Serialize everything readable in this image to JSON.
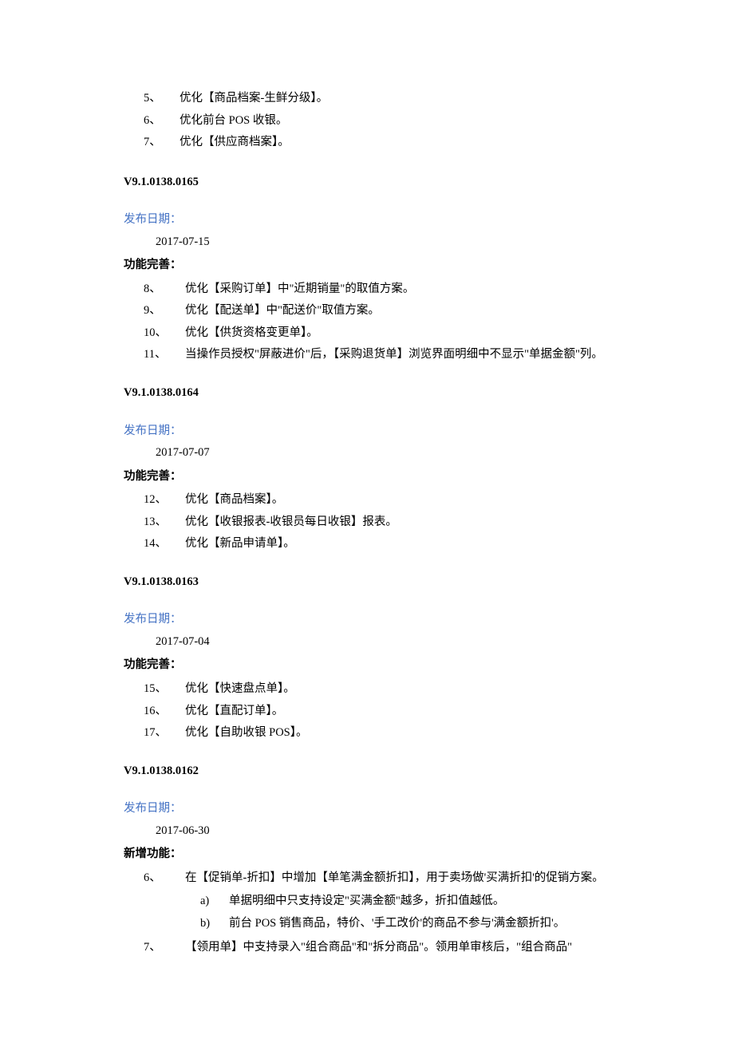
{
  "topItems": [
    {
      "num": "5、",
      "text": "优化【商品档案-生鲜分级】。"
    },
    {
      "num": "6、",
      "text": "优化前台 POS 收银。"
    },
    {
      "num": "7、",
      "text": "优化【供应商档案】。"
    }
  ],
  "labels": {
    "releaseDate": "发布日期：",
    "improvements": "功能完善：",
    "newFeatures": "新增功能："
  },
  "versions": [
    {
      "version": "V9.1.0138.0165",
      "date": "2017-07-15",
      "improvementItems": [
        {
          "num": "8、",
          "text": "优化【采购订单】中\"近期销量\"的取值方案。"
        },
        {
          "num": "9、",
          "text": "优化【配送单】中\"配送价\"取值方案。"
        },
        {
          "num": "10、",
          "text": "优化【供货资格变更单】。"
        },
        {
          "num": "11、",
          "text": "当操作员授权\"屏蔽进价\"后，【采购退货单】浏览界面明细中不显示\"单据金额\"列。"
        }
      ]
    },
    {
      "version": "V9.1.0138.0164",
      "date": "2017-07-07",
      "improvementItems": [
        {
          "num": "12、",
          "text": "优化【商品档案】。"
        },
        {
          "num": "13、",
          "text": "优化【收银报表-收银员每日收银】报表。"
        },
        {
          "num": "14、",
          "text": "优化【新品申请单】。"
        }
      ]
    },
    {
      "version": "V9.1.0138.0163",
      "date": "2017-07-04",
      "improvementItems": [
        {
          "num": "15、",
          "text": "优化【快速盘点单】。"
        },
        {
          "num": "16、",
          "text": "优化【直配订单】。"
        },
        {
          "num": "17、",
          "text": "优化【自助收银 POS】。"
        }
      ]
    },
    {
      "version": "V9.1.0138.0162",
      "date": "2017-06-30",
      "newFeatureItems": [
        {
          "num": "6、",
          "text": "在【促销单-折扣】中增加【单笔满金额折扣】，用于卖场做'买满折扣'的促销方案。",
          "sub": [
            {
              "label": "a)",
              "text": "单据明细中只支持设定\"买满金额\"越多，折扣值越低。"
            },
            {
              "label": "b)",
              "text": "前台 POS 销售商品，特价、'手工改价'的商品不参与'满金额折扣'。"
            }
          ]
        },
        {
          "num": "7、",
          "text": "【领用单】中支持录入\"组合商品\"和\"拆分商品\"。领用单审核后，\"组合商品\""
        }
      ]
    }
  ]
}
